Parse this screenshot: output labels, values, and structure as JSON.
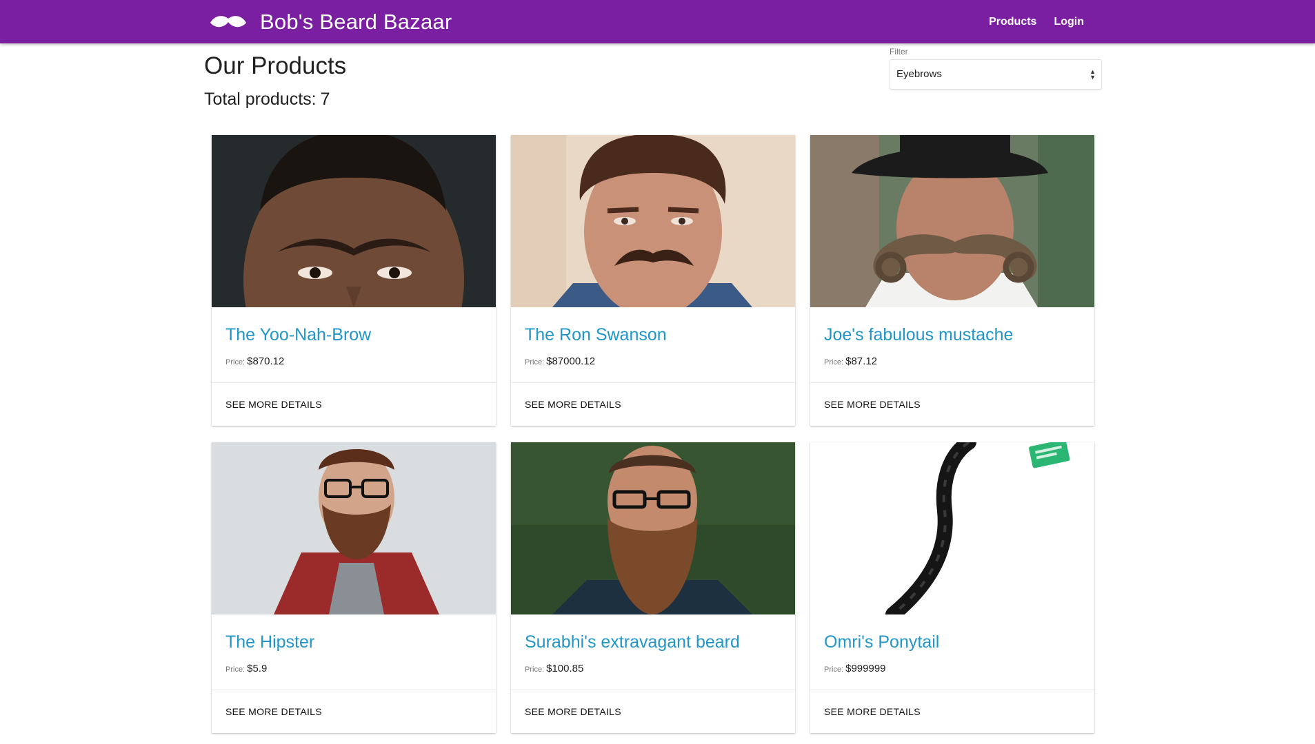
{
  "navbar": {
    "brand": "Bob's Beard Bazaar",
    "brand_icon": "mustache-icon",
    "links": [
      "Products",
      "Login"
    ],
    "color": "#7b1fa2"
  },
  "main": {
    "title": "Our Products",
    "total_label": "Total products:",
    "total_count": "7"
  },
  "filter": {
    "label": "Filter",
    "selected": "Eyebrows"
  },
  "products": [
    {
      "name": "The Yoo-Nah-Brow",
      "price_label": "Price:",
      "price": "$870.12",
      "action": "SEE MORE DETAILS",
      "image": "unibrow-face"
    },
    {
      "name": "The Ron Swanson",
      "price_label": "Price:",
      "price": "$87000.12",
      "action": "SEE MORE DETAILS",
      "image": "mustache-face"
    },
    {
      "name": "Joe's fabulous mustache",
      "price_label": "Price:",
      "price": "$87.12",
      "action": "SEE MORE DETAILS",
      "image": "curled-mustache-face"
    },
    {
      "name": "The Hipster",
      "price_label": "Price:",
      "price": "$5.9",
      "action": "SEE MORE DETAILS",
      "image": "hipster-beard-face"
    },
    {
      "name": "Surabhi's extravagant beard",
      "price_label": "Price:",
      "price": "$100.85",
      "action": "SEE MORE DETAILS",
      "image": "long-beard-face"
    },
    {
      "name": "Omri's Ponytail",
      "price_label": "Price:",
      "price": "$999999",
      "action": "SEE MORE DETAILS",
      "image": "braided-ponytail"
    }
  ],
  "colors": {
    "accent": "#7b1fa2",
    "link": "#2196c8"
  }
}
